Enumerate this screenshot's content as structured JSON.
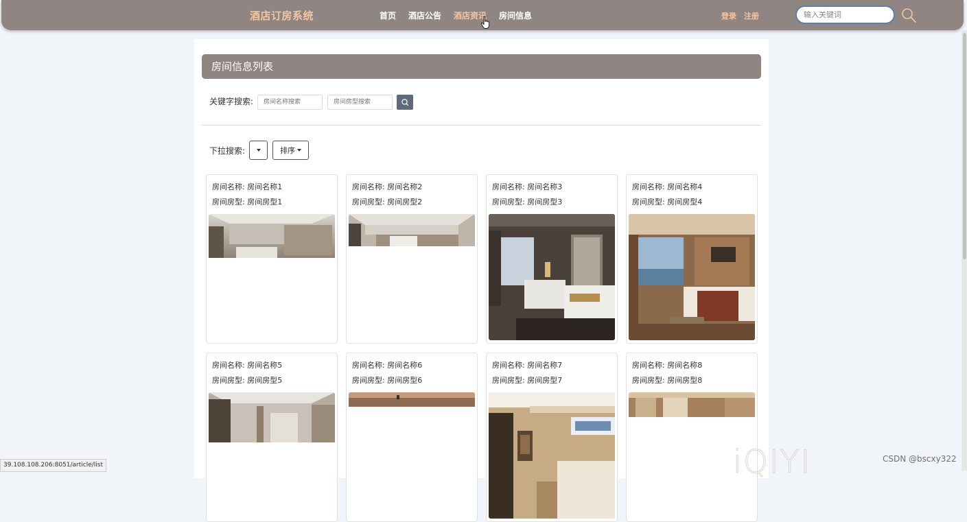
{
  "header": {
    "brand": "酒店订房系统",
    "nav": [
      {
        "label": "首页"
      },
      {
        "label": "酒店公告"
      },
      {
        "label": "酒店资讯"
      },
      {
        "label": "房间信息"
      }
    ],
    "login": "登录",
    "register": "注册",
    "search_placeholder": "输入关键词"
  },
  "panel": {
    "title": "房间信息列表",
    "keyword_label": "关键字搜索:",
    "name_placeholder": "房间名称搜索",
    "type_placeholder": "房间房型搜索",
    "dropdown_label": "下拉搜索:",
    "sort_label": "排序"
  },
  "cards": [
    {
      "name": "房间名称: 房间名称1",
      "type": "房间房型: 房间房型1"
    },
    {
      "name": "房间名称: 房间名称2",
      "type": "房间房型: 房间房型2"
    },
    {
      "name": "房间名称: 房间名称3",
      "type": "房间房型: 房间房型3"
    },
    {
      "name": "房间名称: 房间名称4",
      "type": "房间房型: 房间房型4"
    },
    {
      "name": "房间名称: 房间名称5",
      "type": "房间房型: 房间房型5"
    },
    {
      "name": "房间名称: 房间名称6",
      "type": "房间房型: 房间房型6"
    },
    {
      "name": "房间名称: 房间名称7",
      "type": "房间房型: 房间房型7"
    },
    {
      "name": "房间名称: 房间名称8",
      "type": "房间房型: 房间房型8"
    }
  ],
  "status_url": "39.108.108.206:8051/article/list",
  "watermark": "iQIYI",
  "credit": "CSDN @bscxy322",
  "colors": {
    "header_bg": "#8f8583",
    "accent": "#f2c6a0",
    "search_button": "#5f6b7a"
  }
}
